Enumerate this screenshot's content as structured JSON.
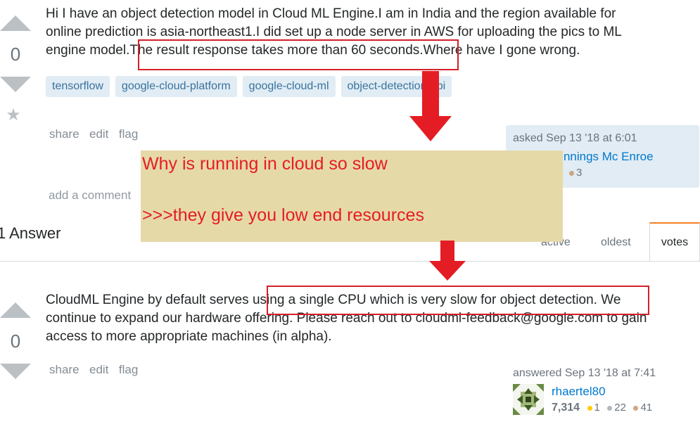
{
  "question": {
    "vote_count": "0",
    "body_lines": [
      "Hi I have an object detection model in Cloud ML Engine.I am in India and the region available for",
      "online prediction is asia-northeast1.I did set up a node server in AWS for uploading the pics to ML",
      "engine model.The result response takes more than 60 seconds.Where have I gone wrong."
    ],
    "tags": [
      "tensorflow",
      "google-cloud-platform",
      "google-cloud-ml",
      "object-detection-api"
    ],
    "menu": {
      "share": "share",
      "edit": "edit",
      "flag": "flag"
    },
    "add_comment": "add a comment",
    "signature": {
      "action": "asked Sep 13 '18 at 6:01",
      "user": "Jennings Mc Enroe",
      "bronze": "3"
    }
  },
  "answers_header": {
    "count_label": "1 Answer",
    "tabs": [
      "active",
      "oldest",
      "votes"
    ],
    "selected_tab": "votes"
  },
  "answer": {
    "vote_count": "0",
    "body_lines": [
      "CloudML Engine by default serves using a single CPU which is very slow for object detection. We",
      "continue to expand our hardware offering. Please reach out to cloudml-feedback@google.com to gain",
      "access to more appropriate machines (in alpha)."
    ],
    "menu": {
      "share": "share",
      "edit": "edit",
      "flag": "flag"
    },
    "signature": {
      "action": "answered Sep 13 '18 at 7:41",
      "user": "rhaertel80",
      "reputation": "7,314",
      "gold": "1",
      "silver": "22",
      "bronze": "41"
    }
  },
  "annotation": {
    "line1": "Why is running in cloud so slow",
    "line2": ">>>they give you low end resources"
  },
  "colors": {
    "accent_red": "#e41d24",
    "note_bg": "#e6d9a8",
    "tag_bg": "#e1ecf4",
    "link": "#0077cc"
  }
}
